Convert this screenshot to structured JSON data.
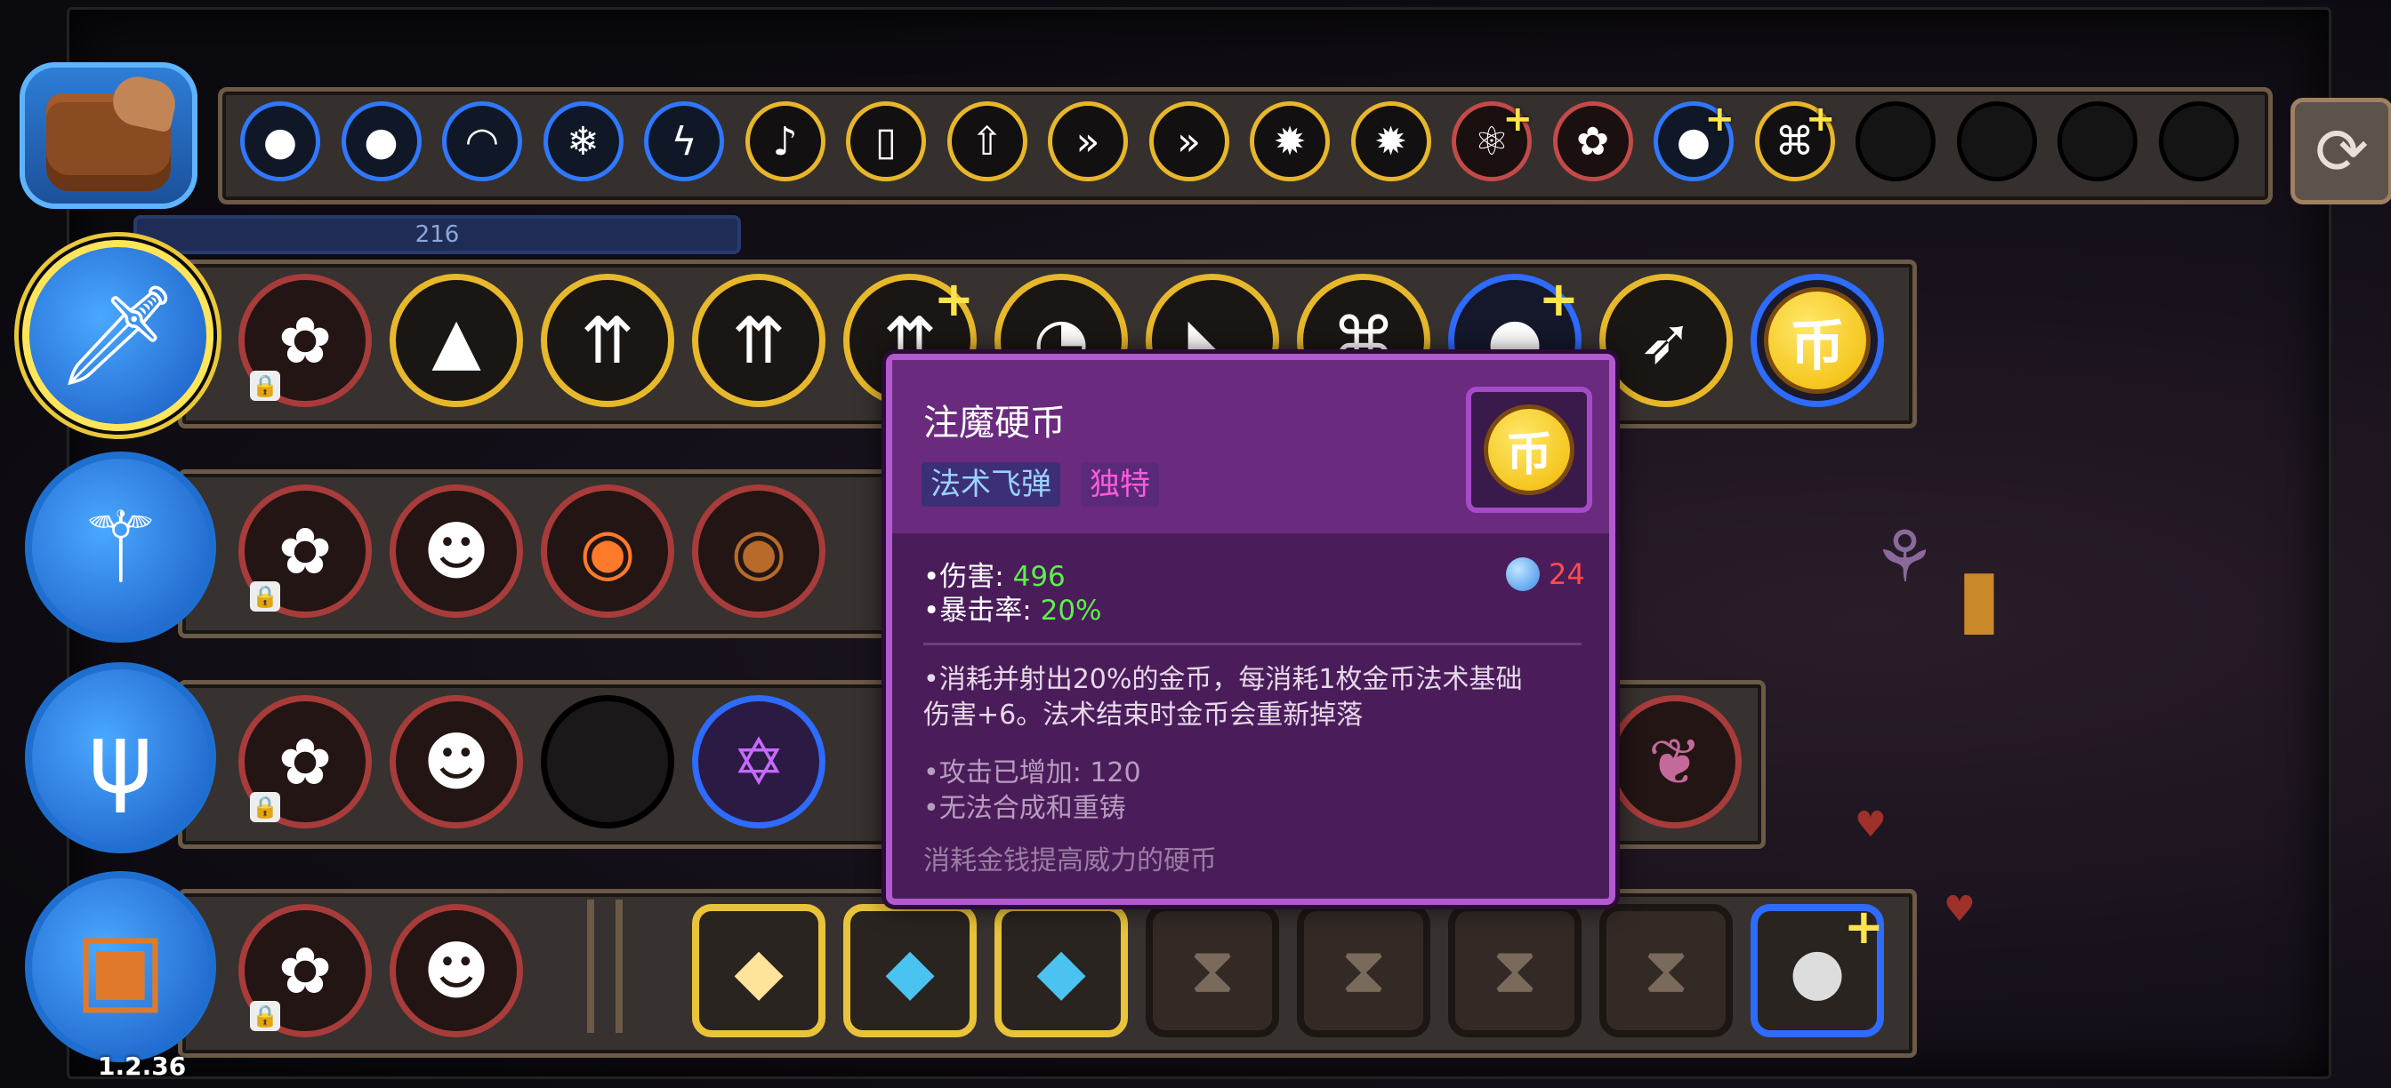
{
  "version": "1.2.36",
  "xp": {
    "value": "216"
  },
  "inventory": {
    "icon": "bag-icon",
    "slots": [
      {
        "icon": "snowball-icon",
        "border": "blue",
        "glyph": "●"
      },
      {
        "icon": "stone-icon",
        "border": "blue",
        "glyph": "●"
      },
      {
        "icon": "rainbow-icon",
        "border": "blue",
        "glyph": "◠"
      },
      {
        "icon": "ice-shard-icon",
        "border": "blue",
        "glyph": "❄"
      },
      {
        "icon": "lightning-ring-icon",
        "border": "blue",
        "glyph": "ϟ"
      },
      {
        "icon": "note-icon",
        "border": "gold",
        "glyph": "♪"
      },
      {
        "icon": "mouse-icon",
        "border": "gold",
        "glyph": "▯"
      },
      {
        "icon": "triple-arrow-icon",
        "border": "gold",
        "glyph": "⇧"
      },
      {
        "icon": "double-chevron-icon",
        "border": "gold",
        "glyph": "»"
      },
      {
        "icon": "double-chevron-icon",
        "border": "gold",
        "glyph": "»"
      },
      {
        "icon": "sun-icon",
        "border": "gold",
        "glyph": "✹"
      },
      {
        "icon": "sun-icon",
        "border": "gold",
        "glyph": "✹"
      },
      {
        "icon": "molecule-icon",
        "border": "red",
        "glyph": "⚛",
        "plus": true
      },
      {
        "icon": "flower-icon",
        "border": "red",
        "glyph": "✿"
      },
      {
        "icon": "snowball-icon",
        "border": "blue",
        "glyph": "●",
        "plus": true
      },
      {
        "icon": "frame-icon",
        "border": "gold",
        "glyph": "⌘",
        "plus": true
      },
      {
        "icon": "empty-slot",
        "border": "empty",
        "glyph": ""
      },
      {
        "icon": "empty-slot",
        "border": "empty",
        "glyph": ""
      },
      {
        "icon": "empty-slot",
        "border": "empty",
        "glyph": ""
      },
      {
        "icon": "empty-slot",
        "border": "empty",
        "glyph": ""
      }
    ]
  },
  "weapons": [
    {
      "name": "sword-icon",
      "glyph": "🗡",
      "selected": true
    },
    {
      "name": "staff-icon",
      "glyph": "⚚",
      "selected": false
    },
    {
      "name": "branch-staff-icon",
      "glyph": "ψ",
      "selected": false
    },
    {
      "name": "spellbook-icon",
      "glyph": "▣",
      "selected": false
    }
  ],
  "tooltip": {
    "title": "注魔硬币",
    "tags": [
      "法术飞弹",
      "独特"
    ],
    "icon": "coin-icon",
    "coin_glyph": "币",
    "damage_label": "•伤害:",
    "damage_value": "496",
    "crit_label": "•暴击率:",
    "crit_value": "20%",
    "mana_cost": "24",
    "desc_line1": "•消耗并射出20%的金币，每消耗1枚金币法术基础",
    "desc_line2": "伤害+6。法术结束时金币会重新掉落",
    "bonus_line": "•攻击已增加: 120",
    "craft_line": "•无法合成和重铸",
    "flavor": "消耗金钱提高威力的硬币"
  },
  "colors": {
    "gold": "#e8b82b",
    "blue": "#2e6bff",
    "red": "#a83c3a",
    "tooltip_bg": "#4a1d5a",
    "tooltip_border": "#b45ad0",
    "stat_green": "#5cf04a",
    "mana_red": "#ff4c4c"
  }
}
